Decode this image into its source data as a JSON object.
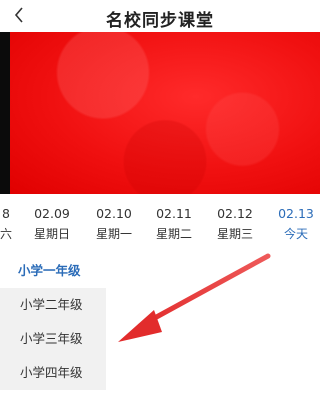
{
  "header": {
    "title": "名校同步课堂",
    "back_icon": "back-arrow-icon"
  },
  "video": {
    "state": "blurred"
  },
  "dates": [
    {
      "date": "8",
      "day": "六",
      "active": false
    },
    {
      "date": "02.09",
      "day": "星期日",
      "active": false
    },
    {
      "date": "02.10",
      "day": "星期一",
      "active": false
    },
    {
      "date": "02.11",
      "day": "星期二",
      "active": false
    },
    {
      "date": "02.12",
      "day": "星期三",
      "active": false
    },
    {
      "date": "02.13",
      "day": "今天",
      "active": true
    }
  ],
  "grades": {
    "selected": "小学一年级",
    "options": [
      "小学二年级",
      "小学三年级",
      "小学四年级"
    ]
  },
  "colors": {
    "accent": "#2b6cb8",
    "arrow": "#e23636",
    "video": "#f01010"
  }
}
